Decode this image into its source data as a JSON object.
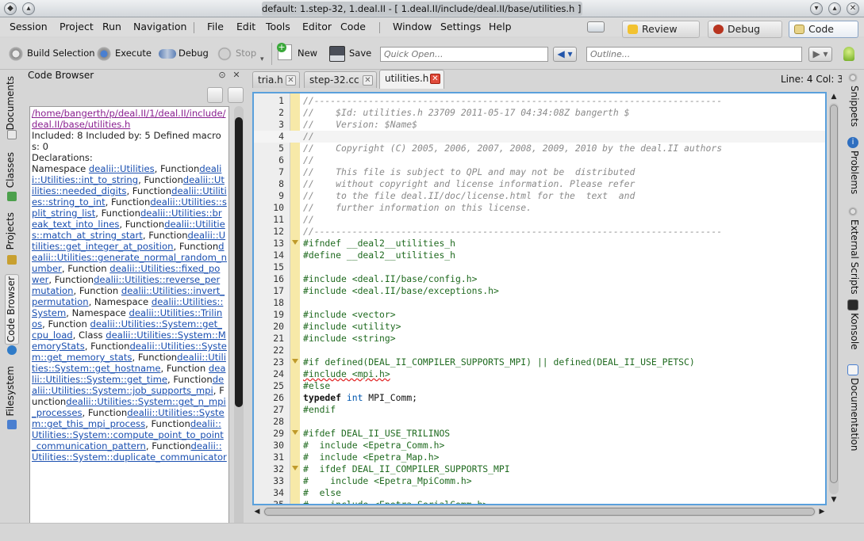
{
  "window": {
    "title": "default:  1.step-32, 1.deal.II - [ 1.deal.II/include/deal.II/base/utilities.h ] – KDevelop"
  },
  "menubar": {
    "items": [
      "Session",
      "Project",
      "Run",
      "Navigation",
      "File",
      "Edit",
      "Tools",
      "Editor",
      "Code",
      "Window",
      "Settings",
      "Help"
    ]
  },
  "areas": {
    "review": "Review",
    "debug": "Debug",
    "code": "Code"
  },
  "toolbar": {
    "build_selection": "Build Selection",
    "execute": "Execute",
    "debug": "Debug",
    "stop": "Stop",
    "new": "New",
    "save": "Save",
    "quick_open_placeholder": "Quick Open...",
    "outline_placeholder": "Outline..."
  },
  "left_tabs": [
    "Documents",
    "Classes",
    "Projects",
    "Code Browser",
    "Filesystem"
  ],
  "right_tabs": [
    "Snippets",
    "Problems",
    "External Scripts",
    "Konsole",
    "Documentation"
  ],
  "code_browser": {
    "title": "Code Browser",
    "path": "/home/bangerth/p/deal.II/1/deal.II/include/deal.II/base/utilities.h",
    "summary": "Included: 8 Included by: 5 Defined macros: 0",
    "declarations_label": "Declarations:",
    "entries": [
      {
        "prefix": "Namespace ",
        "link": "dealii::Utilities",
        "suffix": ", Function"
      },
      {
        "prefix": "",
        "link": "dealii::Utilities::int_to_string",
        "suffix": ", Function"
      },
      {
        "prefix": "",
        "link": "dealii::Utilities::needed_digits",
        "suffix": ", Function"
      },
      {
        "prefix": "",
        "link": "dealii::Utilities::string_to_int",
        "suffix": ", Function"
      },
      {
        "prefix": "",
        "link": "dealii::Utilities::split_string_list",
        "suffix": ", Function"
      },
      {
        "prefix": "",
        "link": "dealii::Utilities::break_text_into_lines",
        "suffix": ", Function"
      },
      {
        "prefix": "",
        "link": "dealii::Utilities::match_at_string_start",
        "suffix": ", Function"
      },
      {
        "prefix": "",
        "link": "dealii::Utilities::get_integer_at_position",
        "suffix": ", Function"
      },
      {
        "prefix": "",
        "link": "dealii::Utilities::generate_normal_random_number",
        "suffix": ", Function "
      },
      {
        "prefix": "",
        "link": "dealii::Utilities::fixed_power",
        "suffix": ", Function"
      },
      {
        "prefix": "",
        "link": "dealii::Utilities::reverse_permutation",
        "suffix": ", Function "
      },
      {
        "prefix": "",
        "link": "dealii::Utilities::invert_permutation",
        "suffix": ", Namespace "
      },
      {
        "prefix": "",
        "link": "dealii::Utilities::System",
        "suffix": ", Namespace "
      },
      {
        "prefix": "",
        "link": "dealii::Utilities::Trilinos",
        "suffix": ", Function "
      },
      {
        "prefix": "",
        "link": "dealii::Utilities::System::get_cpu_load",
        "suffix": ", Class "
      },
      {
        "prefix": "",
        "link": "dealii::Utilities::System::MemoryStats",
        "suffix": ", Function"
      },
      {
        "prefix": "",
        "link": "dealii::Utilities::System::get_memory_stats",
        "suffix": ", Function"
      },
      {
        "prefix": "",
        "link": "dealii::Utilities::System::get_hostname",
        "suffix": ", Function "
      },
      {
        "prefix": "",
        "link": "dealii::Utilities::System::get_time",
        "suffix": ", Function"
      },
      {
        "prefix": "",
        "link": "dealii::Utilities::System::job_supports_mpi",
        "suffix": ", Function"
      },
      {
        "prefix": "",
        "link": "dealii::Utilities::System::get_n_mpi_processes",
        "suffix": ", Function"
      },
      {
        "prefix": "",
        "link": "dealii::Utilities::System::get_this_mpi_process",
        "suffix": ", Function"
      },
      {
        "prefix": "",
        "link": "dealii::Utilities::System::compute_point_to_point_communication_pattern",
        "suffix": ", Function"
      },
      {
        "prefix": "",
        "link": "dealii::Utilities::System::duplicate_communicator",
        "suffix": ""
      }
    ]
  },
  "editor": {
    "tabs": [
      {
        "label": "tria.h",
        "active": false
      },
      {
        "label": "step-32.cc",
        "active": false
      },
      {
        "label": "utilities.h",
        "active": true
      }
    ],
    "cursor_position": "Line: 4 Col: 3",
    "current_line": 4,
    "lines": [
      {
        "n": "1",
        "fold": false,
        "kind": "comment",
        "text": "//---------------------------------------------------------------------------"
      },
      {
        "n": "2",
        "fold": false,
        "kind": "comment",
        "text": "//    $Id: utilities.h 23709 2011-05-17 04:34:08Z bangerth $"
      },
      {
        "n": "3",
        "fold": false,
        "kind": "comment",
        "text": "//    Version: $Name$"
      },
      {
        "n": "4",
        "fold": false,
        "kind": "comment",
        "text": "//"
      },
      {
        "n": "5",
        "fold": false,
        "kind": "comment",
        "text": "//    Copyright (C) 2005, 2006, 2007, 2008, 2009, 2010 by the deal.II authors"
      },
      {
        "n": "6",
        "fold": false,
        "kind": "comment",
        "text": "//"
      },
      {
        "n": "7",
        "fold": false,
        "kind": "comment",
        "text": "//    This file is subject to QPL and may not be  distributed"
      },
      {
        "n": "8",
        "fold": false,
        "kind": "comment",
        "text": "//    without copyright and license information. Please refer"
      },
      {
        "n": "9",
        "fold": false,
        "kind": "comment",
        "text": "//    to the file deal.II/doc/license.html for the  text  and"
      },
      {
        "n": "10",
        "fold": false,
        "kind": "comment",
        "text": "//    further information on this license."
      },
      {
        "n": "11",
        "fold": false,
        "kind": "comment",
        "text": "//"
      },
      {
        "n": "12",
        "fold": false,
        "kind": "comment",
        "text": "//---------------------------------------------------------------------------"
      },
      {
        "n": "13",
        "fold": true,
        "kind": "pre",
        "text": "#ifndef __deal2__utilities_h"
      },
      {
        "n": "14",
        "fold": false,
        "kind": "pre",
        "text": "#define __deal2__utilities_h"
      },
      {
        "n": "15",
        "fold": false,
        "kind": "normal",
        "text": ""
      },
      {
        "n": "16",
        "fold": false,
        "kind": "pre",
        "text": "#include <deal.II/base/config.h>"
      },
      {
        "n": "17",
        "fold": false,
        "kind": "pre",
        "text": "#include <deal.II/base/exceptions.h>"
      },
      {
        "n": "18",
        "fold": false,
        "kind": "normal",
        "text": ""
      },
      {
        "n": "19",
        "fold": false,
        "kind": "pre",
        "text": "#include <vector>"
      },
      {
        "n": "20",
        "fold": false,
        "kind": "pre",
        "text": "#include <utility>"
      },
      {
        "n": "21",
        "fold": false,
        "kind": "pre",
        "text": "#include <string>"
      },
      {
        "n": "22",
        "fold": false,
        "kind": "normal",
        "text": ""
      },
      {
        "n": "23",
        "fold": true,
        "kind": "pre",
        "text": "#if defined(DEAL_II_COMPILER_SUPPORTS_MPI) || defined(DEAL_II_USE_PETSC)"
      },
      {
        "n": "24",
        "fold": false,
        "kind": "pre-squiggle",
        "text": "#include <mpi.h>"
      },
      {
        "n": "25",
        "fold": false,
        "kind": "pre",
        "text": "#else"
      },
      {
        "n": "26",
        "fold": false,
        "kind": "typedef",
        "kw": "typedef",
        "ty": "int",
        "rest": " MPI_Comm;"
      },
      {
        "n": "27",
        "fold": false,
        "kind": "pre",
        "text": "#endif"
      },
      {
        "n": "28",
        "fold": false,
        "kind": "normal",
        "text": ""
      },
      {
        "n": "29",
        "fold": true,
        "kind": "pre",
        "text": "#ifdef DEAL_II_USE_TRILINOS"
      },
      {
        "n": "30",
        "fold": false,
        "kind": "pre",
        "text": "#  include <Epetra_Comm.h>"
      },
      {
        "n": "31",
        "fold": false,
        "kind": "pre",
        "text": "#  include <Epetra_Map.h>"
      },
      {
        "n": "32",
        "fold": true,
        "kind": "pre",
        "text": "#  ifdef DEAL_II_COMPILER_SUPPORTS_MPI"
      },
      {
        "n": "33",
        "fold": false,
        "kind": "pre",
        "text": "#    include <Epetra_MpiComm.h>"
      },
      {
        "n": "34",
        "fold": false,
        "kind": "pre",
        "text": "#  else"
      },
      {
        "n": "35",
        "fold": false,
        "kind": "pre",
        "text": "#    include <Epetra_SerialComm.h>"
      }
    ]
  },
  "colors": {
    "accent": "#5aa0dc",
    "link": "#1a4fb0",
    "fold_bar": "#f7e9a8",
    "comment": "#8a8a8a",
    "preprocessor": "#1f6a1f"
  }
}
